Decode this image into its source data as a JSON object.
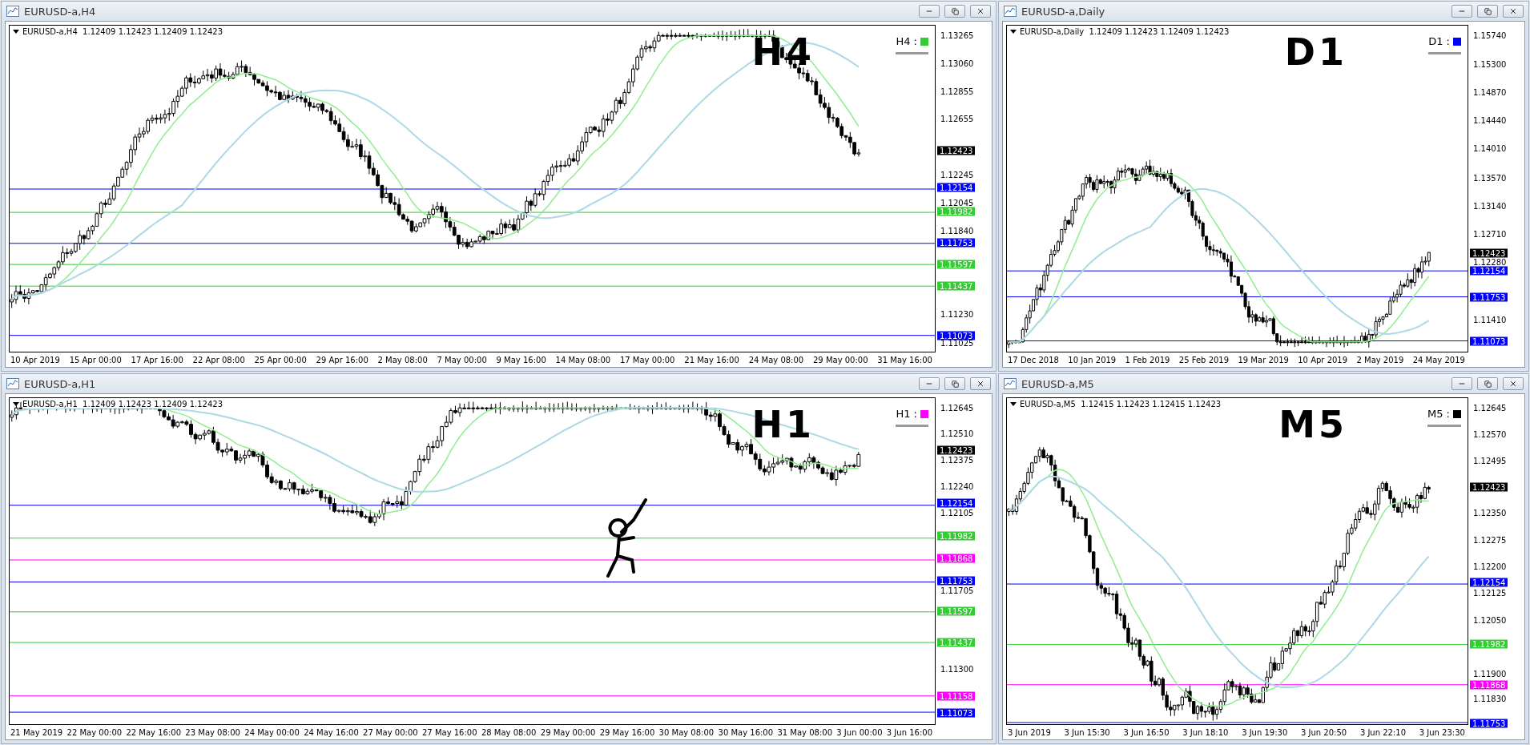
{
  "windows": [
    {
      "title": "EURUSD-a,H4",
      "info": "EURUSD-a,H4  1.12409 1.12423 1.12409 1.12423",
      "annotation": "H4",
      "legend": {
        "label": "H4 :",
        "color": "#33cc33"
      },
      "price_ticks": [
        "1.13265",
        "1.13060",
        "1.12855",
        "1.12655",
        "1.12245",
        "1.12045",
        "1.11840",
        "1.11230",
        "1.11025"
      ],
      "price_tags": [
        {
          "label": "1.12423",
          "kind": "bid",
          "color": "#000000"
        },
        {
          "label": "1.12154",
          "kind": "line",
          "color": "#0000ff"
        },
        {
          "label": "1.11982",
          "kind": "line",
          "color": "#33cc33"
        },
        {
          "label": "1.11753",
          "kind": "line",
          "color": "#0000ff"
        },
        {
          "label": "1.11597",
          "kind": "line",
          "color": "#33cc33"
        },
        {
          "label": "1.11437",
          "kind": "line",
          "color": "#33cc33"
        },
        {
          "label": "1.11073",
          "kind": "line",
          "color": "#0000ff"
        }
      ],
      "time_labels": [
        "10 Apr 2019",
        "15 Apr 00:00",
        "17 Apr 16:00",
        "22 Apr 08:00",
        "25 Apr 00:00",
        "29 Apr 16:00",
        "2 May 08:00",
        "7 May 00:00",
        "9 May 16:00",
        "14 May 08:00",
        "17 May 00:00",
        "21 May 16:00",
        "24 May 08:00",
        "29 May 00:00",
        "31 May 16:00"
      ]
    },
    {
      "title": "EURUSD-a,Daily",
      "info": "EURUSD-a,Daily  1.12409 1.12423 1.12409 1.12423",
      "annotation": "D1",
      "legend": {
        "label": "D1 :",
        "color": "#0000ff"
      },
      "price_ticks": [
        "1.15740",
        "1.15300",
        "1.14870",
        "1.14440",
        "1.14010",
        "1.13570",
        "1.13140",
        "1.12710",
        "1.12280",
        "1.11410"
      ],
      "price_tags": [
        {
          "label": "1.12423",
          "kind": "bid",
          "color": "#000000"
        },
        {
          "label": "1.12154",
          "kind": "line",
          "color": "#0000ff"
        },
        {
          "label": "1.11753",
          "kind": "line",
          "color": "#0000ff"
        },
        {
          "label": "1.11073",
          "kind": "line",
          "color": "#0000ff"
        }
      ],
      "time_labels": [
        "17 Dec 2018",
        "10 Jan 2019",
        "1 Feb 2019",
        "25 Feb 2019",
        "19 Mar 2019",
        "10 Apr 2019",
        "2 May 2019",
        "24 May 2019"
      ]
    },
    {
      "title": "EURUSD-a,H1",
      "info": "EURUSD-a,H1  1.12409 1.12423 1.12409 1.12423",
      "annotation": "H1",
      "legend": {
        "label": "H1 :",
        "color": "#ff00ff"
      },
      "price_ticks": [
        "1.12645",
        "1.12510",
        "1.12375",
        "1.12240",
        "1.12105",
        "1.11705",
        "1.11300"
      ],
      "price_tags": [
        {
          "label": "1.12423",
          "kind": "bid",
          "color": "#000000"
        },
        {
          "label": "1.12154",
          "kind": "line",
          "color": "#0000ff"
        },
        {
          "label": "1.11982",
          "kind": "line",
          "color": "#33cc33"
        },
        {
          "label": "1.11868",
          "kind": "line",
          "color": "#ff00ff"
        },
        {
          "label": "1.11753",
          "kind": "line",
          "color": "#0000ff"
        },
        {
          "label": "1.11597",
          "kind": "line",
          "color": "#33cc33"
        },
        {
          "label": "1.11437",
          "kind": "line",
          "color": "#33cc33"
        },
        {
          "label": "1.11158",
          "kind": "line",
          "color": "#ff00ff"
        },
        {
          "label": "1.11073",
          "kind": "line",
          "color": "#0000ff"
        }
      ],
      "time_labels": [
        "21 May 2019",
        "22 May 00:00",
        "22 May 16:00",
        "23 May 08:00",
        "24 May 00:00",
        "24 May 16:00",
        "27 May 00:00",
        "27 May 16:00",
        "28 May 08:00",
        "29 May 00:00",
        "29 May 16:00",
        "30 May 08:00",
        "30 May 16:00",
        "31 May 08:00",
        "3 Jun 00:00",
        "3 Jun 16:00"
      ]
    },
    {
      "title": "EURUSD-a,M5",
      "info": "EURUSD-a,M5  1.12415 1.12423 1.12415 1.12423",
      "annotation": "M5",
      "legend": {
        "label": "M5 :",
        "color": "#000000"
      },
      "price_ticks": [
        "1.12645",
        "1.12570",
        "1.12495",
        "1.12350",
        "1.12275",
        "1.12200",
        "1.12125",
        "1.12050",
        "1.11900",
        "1.11830"
      ],
      "price_tags": [
        {
          "label": "1.12423",
          "kind": "bid",
          "color": "#000000"
        },
        {
          "label": "1.12154",
          "kind": "line",
          "color": "#0000ff"
        },
        {
          "label": "1.11982",
          "kind": "line",
          "color": "#33cc33"
        },
        {
          "label": "1.11868",
          "kind": "line",
          "color": "#ff00ff"
        },
        {
          "label": "1.11753",
          "kind": "line",
          "color": "#0000ff"
        }
      ],
      "time_labels": [
        "3 Jun 2019",
        "3 Jun 15:30",
        "3 Jun 16:50",
        "3 Jun 18:10",
        "3 Jun 19:30",
        "3 Jun 20:50",
        "3 Jun 22:10",
        "3 Jun 23:30"
      ]
    }
  ]
}
